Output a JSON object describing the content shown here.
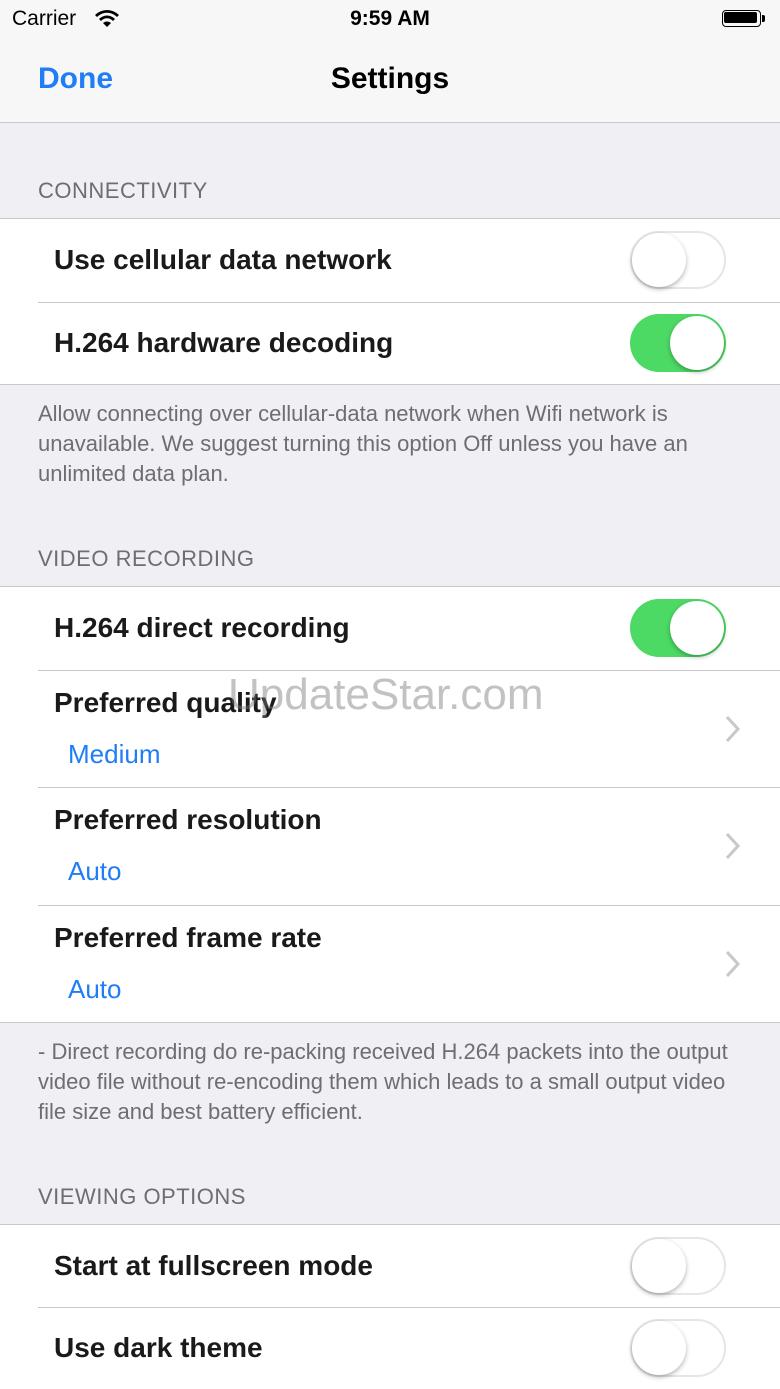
{
  "status_bar": {
    "carrier": "Carrier",
    "time": "9:59 AM"
  },
  "nav": {
    "done_label": "Done",
    "title": "Settings"
  },
  "connectivity": {
    "header": "CONNECTIVITY",
    "rows": [
      {
        "label": "Use cellular data network",
        "toggle": "off"
      },
      {
        "label": "H.264 hardware decoding",
        "toggle": "on"
      }
    ],
    "footer": "Allow connecting over cellular-data network when Wifi network is unavailable. We suggest turning this option Off unless you have an unlimited data plan."
  },
  "video_recording": {
    "header": "VIDEO RECORDING",
    "direct_recording": {
      "label": "H.264 direct recording",
      "toggle": "on"
    },
    "quality": {
      "label": "Preferred quality",
      "value": "Medium"
    },
    "resolution": {
      "label": "Preferred resolution",
      "value": "Auto"
    },
    "frame_rate": {
      "label": "Preferred frame rate",
      "value": "Auto"
    },
    "footer": "- Direct recording do re-packing received H.264 packets into the output video file without re-encoding them which leads to a small output video file size and best battery efficient."
  },
  "viewing_options": {
    "header": "VIEWING OPTIONS",
    "rows": [
      {
        "label": "Start at fullscreen mode",
        "toggle": "off"
      },
      {
        "label": "Use dark theme",
        "toggle": "off"
      }
    ]
  },
  "watermark": "UpdateStar.com",
  "colors": {
    "accent": "#1f7ef6",
    "toggle_on": "#4cd964",
    "background": "#efeff4"
  }
}
